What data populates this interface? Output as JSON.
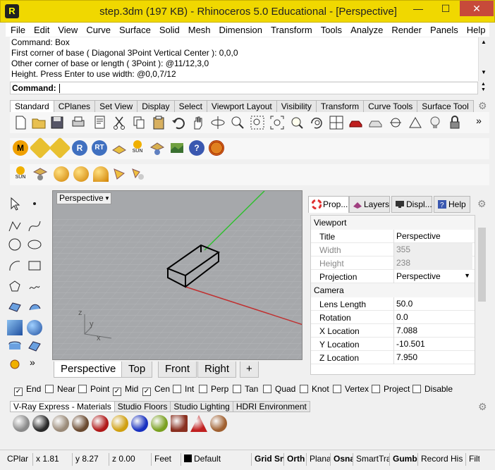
{
  "window": {
    "title": "step.3dm (197 KB) - Rhinoceros 5.0 Educational - [Perspective]",
    "minimize": "—",
    "maximize": "☐",
    "close": "✕"
  },
  "menu": [
    "File",
    "Edit",
    "View",
    "Curve",
    "Surface",
    "Solid",
    "Mesh",
    "Dimension",
    "Transform",
    "Tools",
    "Analyze",
    "Render",
    "Panels",
    "Help"
  ],
  "command": {
    "history": [
      "Command: Box",
      "First corner of base ( Diagonal  3Point  Vertical  Center ): 0,0,0",
      "Other corner of base or length ( 3Point ): @11/12,3,0",
      "Height. Press Enter to use width: @0,0,7/12"
    ],
    "prompt": "Command:"
  },
  "toolbar_tabs": [
    "Standard",
    "CPlanes",
    "Set View",
    "Display",
    "Select",
    "Viewport Layout",
    "Visibility",
    "Transform",
    "Curve Tools",
    "Surface Tool"
  ],
  "viewport": {
    "title": "Perspective",
    "axis_labels": {
      "z": "z",
      "y": "y",
      "x": "x"
    },
    "tabs": [
      "Perspective",
      "Top",
      "Front",
      "Right"
    ],
    "add_tab": "+"
  },
  "panel_tabs": [
    "Prop...",
    "Layers",
    "Displ...",
    "Help"
  ],
  "properties": {
    "viewport_header": "Viewport",
    "viewport_rows": [
      {
        "key": "Title",
        "value": "Perspective",
        "dim": false
      },
      {
        "key": "Width",
        "value": "355",
        "dim": true
      },
      {
        "key": "Height",
        "value": "238",
        "dim": true
      },
      {
        "key": "Projection",
        "value": "Perspective",
        "dim": false
      }
    ],
    "camera_header": "Camera",
    "camera_rows": [
      {
        "key": "Lens Length",
        "value": "50.0"
      },
      {
        "key": "Rotation",
        "value": "0.0"
      },
      {
        "key": "X Location",
        "value": "7.088"
      },
      {
        "key": "Y Location",
        "value": "-10.501"
      },
      {
        "key": "Z Location",
        "value": "7.950"
      }
    ]
  },
  "osnap": [
    {
      "label": "End",
      "checked": true
    },
    {
      "label": "Near",
      "checked": false
    },
    {
      "label": "Point",
      "checked": false
    },
    {
      "label": "Mid",
      "checked": true
    },
    {
      "label": "Cen",
      "checked": true
    },
    {
      "label": "Int",
      "checked": false
    },
    {
      "label": "Perp",
      "checked": false
    },
    {
      "label": "Tan",
      "checked": false
    },
    {
      "label": "Quad",
      "checked": false
    },
    {
      "label": "Knot",
      "checked": false
    },
    {
      "label": "Vertex",
      "checked": false
    },
    {
      "label": "Project",
      "checked": false
    },
    {
      "label": "Disable",
      "checked": false
    }
  ],
  "material_tabs": [
    "V-Ray Express - Materials",
    "Studio Floors",
    "Studio Lighting",
    "HDRI Environment"
  ],
  "materials": [
    "#8a8a8a",
    "#2a2a2a",
    "#9a8a78",
    "#6a4a30",
    "#b01818",
    "#d0a010",
    "#1830c0",
    "#7aa020",
    "#8a3020",
    "#c02020",
    "#a06030"
  ],
  "status": {
    "cplane": "CPlar",
    "x": "x 1.81",
    "y": "y 8.27",
    "z": "z 0.00",
    "units": "Feet",
    "layer": "Default",
    "toggles": [
      "Grid Sn",
      "Orth",
      "Plana",
      "Osna",
      "SmartTra",
      "Gumb",
      "Record His",
      "Filt"
    ]
  },
  "colors": {
    "titlebar": "#f0d800",
    "close": "#c74a3a",
    "x_axis": "#c03030",
    "y_axis": "#30c030"
  }
}
